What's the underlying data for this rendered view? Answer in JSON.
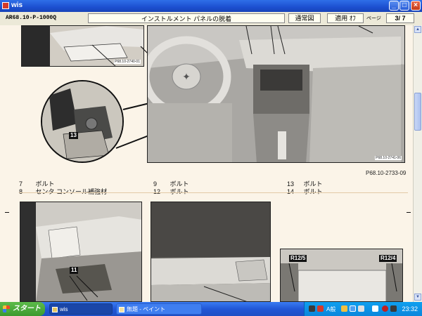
{
  "window": {
    "title": "wis"
  },
  "toolbar": {
    "doc_id": "AR68.10-P-1000Q",
    "doc_title": "インストルメント パネルの脱着",
    "btn_normal": "通常図",
    "btn_apply": "適用 ｵﾌ",
    "page_label": "ページ",
    "page_value": "3/  7"
  },
  "figures": {
    "top_left_code": "P68.10-2740-01",
    "top_right_code": "P68.10-2741-06",
    "figure_ref": "P68.10-2733-09",
    "callout_13": "13",
    "callout_11": "11",
    "callout_r125": "R12/5",
    "callout_r124": "R12/4"
  },
  "legend": [
    {
      "num": "7",
      "text": "ボルト"
    },
    {
      "num": "8",
      "text": "センタ コンソール補強材"
    },
    {
      "num": "9",
      "text": "ボルト"
    },
    {
      "num": "12",
      "text": "ボルト"
    },
    {
      "num": "13",
      "text": "ボルト"
    },
    {
      "num": "14",
      "text": "ボルト"
    }
  ],
  "taskbar": {
    "start_label": "スタート",
    "task1": "wis",
    "task2": "無題 - ペイント",
    "tray_text": "A般",
    "clock": "23:32"
  }
}
